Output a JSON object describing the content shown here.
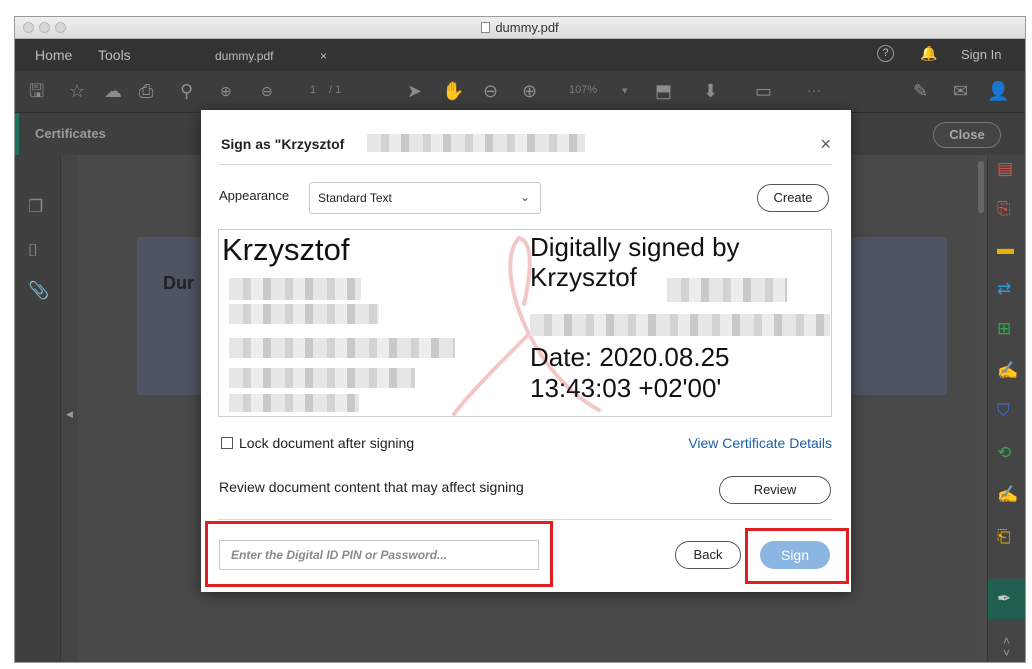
{
  "window": {
    "title": "dummy.pdf"
  },
  "menubar": {
    "home": "Home",
    "tools": "Tools",
    "tab": "dummy.pdf",
    "tab_close": "×",
    "help": "?",
    "signin": "Sign In"
  },
  "toolbar": {
    "page_current": "1",
    "page_total": "/ 1",
    "zoom": "107%",
    "more": "···"
  },
  "certificates_bar": {
    "label": "Certificates",
    "close": "Close"
  },
  "document": {
    "title_partial": "Dur"
  },
  "dialog": {
    "title_prefix": "Sign as \"Krzysztof",
    "title_suffix": "\"",
    "close_glyph": "×",
    "appearance_label": "Appearance",
    "appearance_value": "Standard Text",
    "create_button": "Create",
    "preview": {
      "name": "Krzysztof",
      "signed_line1": "Digitally signed by",
      "signed_line2": "Krzysztof",
      "date_line1": "Date: 2020.08.25",
      "date_line2": "13:43:03 +02'00'"
    },
    "lock_label": "Lock document after signing",
    "lock_checked": false,
    "view_certificate": "View Certificate Details",
    "review_text": "Review document content that may affect signing",
    "review_button": "Review",
    "pin_placeholder": "Enter the Digital ID PIN or Password...",
    "back_button": "Back",
    "sign_button": "Sign"
  },
  "colors": {
    "accent": "#1f6f5f",
    "link": "#1a5ea8",
    "sign_button": "#8bb6e2",
    "highlight": "#e02020"
  }
}
